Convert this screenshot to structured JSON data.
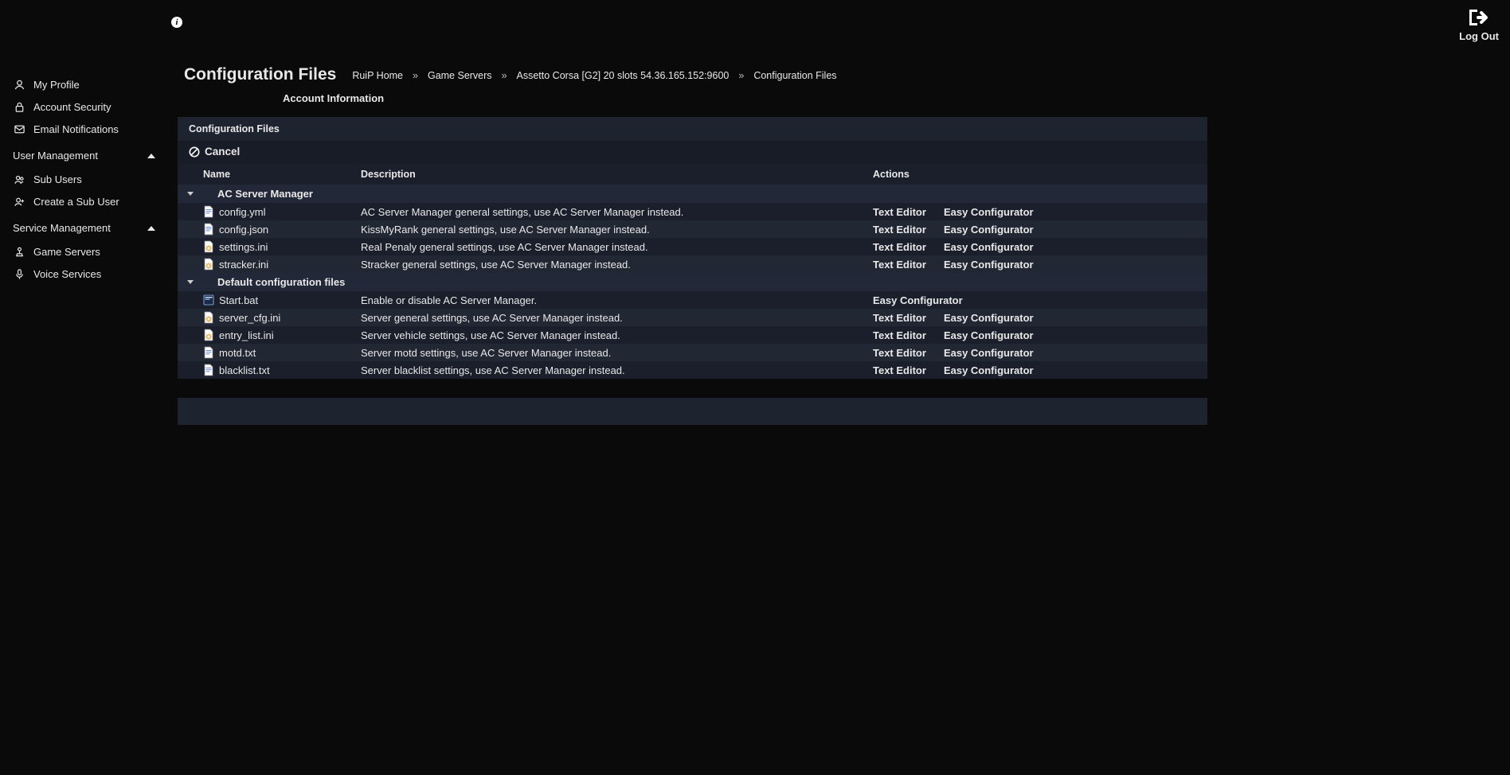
{
  "topbar": {
    "logout_label": "Log Out"
  },
  "sidebar": {
    "items_top": [
      {
        "label": "My Profile",
        "icon": "user"
      },
      {
        "label": "Account Security",
        "icon": "lock"
      },
      {
        "label": "Email Notifications",
        "icon": "mail"
      }
    ],
    "group_user_mgmt": "User Management",
    "items_user_mgmt": [
      {
        "label": "Sub Users",
        "icon": "users"
      },
      {
        "label": "Create a Sub User",
        "icon": "user-add"
      }
    ],
    "group_service_mgmt": "Service Management",
    "items_service_mgmt": [
      {
        "label": "Game Servers",
        "icon": "joystick"
      },
      {
        "label": "Voice Services",
        "icon": "mic"
      }
    ]
  },
  "header": {
    "title": "Configuration Files",
    "breadcrumb": [
      "RuiP Home",
      "Game Servers",
      "Assetto Corsa [G2] 20 slots 54.36.165.152:9600",
      "Configuration Files"
    ],
    "account_info": "Account Information"
  },
  "panel": {
    "title": "Configuration Files",
    "cancel_label": "Cancel",
    "columns": {
      "name": "Name",
      "description": "Description",
      "actions": "Actions"
    },
    "groups": [
      {
        "name": "AC Server Manager",
        "files": [
          {
            "name": "config.yml",
            "icon": "txt",
            "desc": "AC Server Manager general settings, use AC Server Manager instead.",
            "text_editor": true,
            "easy": true
          },
          {
            "name": "config.json",
            "icon": "txt",
            "desc": "KissMyRank general settings, use AC Server Manager instead.",
            "text_editor": true,
            "easy": true
          },
          {
            "name": "settings.ini",
            "icon": "cfg",
            "desc": "Real Penaly general settings, use AC Server Manager instead.",
            "text_editor": true,
            "easy": true
          },
          {
            "name": "stracker.ini",
            "icon": "cfg",
            "desc": "Stracker general settings, use AC Server Manager instead.",
            "text_editor": true,
            "easy": true
          }
        ]
      },
      {
        "name": "Default configuration files",
        "files": [
          {
            "name": "Start.bat",
            "icon": "bat",
            "desc": "Enable or disable AC Server Manager.",
            "text_editor": false,
            "easy": true
          },
          {
            "name": "server_cfg.ini",
            "icon": "cfg",
            "desc": "Server general settings, use AC Server Manager instead.",
            "text_editor": true,
            "easy": true
          },
          {
            "name": "entry_list.ini",
            "icon": "cfg",
            "desc": "Server vehicle settings, use AC Server Manager instead.",
            "text_editor": true,
            "easy": true
          },
          {
            "name": "motd.txt",
            "icon": "txt",
            "desc": "Server motd settings, use AC Server Manager instead.",
            "text_editor": true,
            "easy": true
          },
          {
            "name": "blacklist.txt",
            "icon": "txt",
            "desc": "Server blacklist settings, use AC Server Manager instead.",
            "text_editor": true,
            "easy": true
          }
        ]
      }
    ],
    "text_editor_label": "Text Editor",
    "easy_label": "Easy Configurator"
  }
}
